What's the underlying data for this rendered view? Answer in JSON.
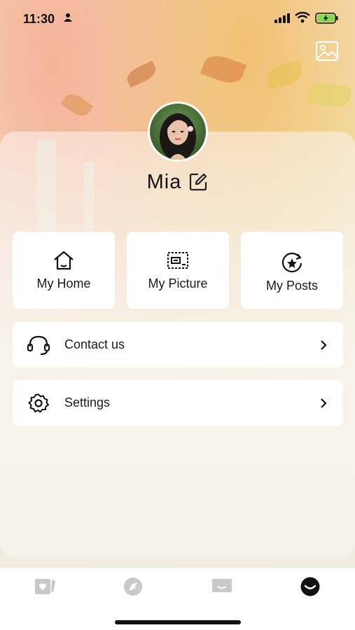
{
  "status_bar": {
    "time": "11:30"
  },
  "profile": {
    "username": "Mia"
  },
  "tiles": [
    {
      "label": "My Home",
      "icon": "home-icon"
    },
    {
      "label": "My Picture",
      "icon": "picture-frame-icon"
    },
    {
      "label": "My Posts",
      "icon": "star-refresh-icon"
    }
  ],
  "menu": [
    {
      "label": "Contact us",
      "icon": "headset-icon"
    },
    {
      "label": "Settings",
      "icon": "gear-icon"
    }
  ],
  "tab_bar": [
    {
      "name": "cards-tab-icon",
      "active": false
    },
    {
      "name": "compass-tab-icon",
      "active": false
    },
    {
      "name": "message-tab-icon",
      "active": false
    },
    {
      "name": "profile-tab-icon",
      "active": true
    }
  ],
  "colors": {
    "active_tab": "#111111",
    "inactive_tab": "#c9c9c9",
    "card": "#ffffff",
    "battery": "#7ed957"
  }
}
